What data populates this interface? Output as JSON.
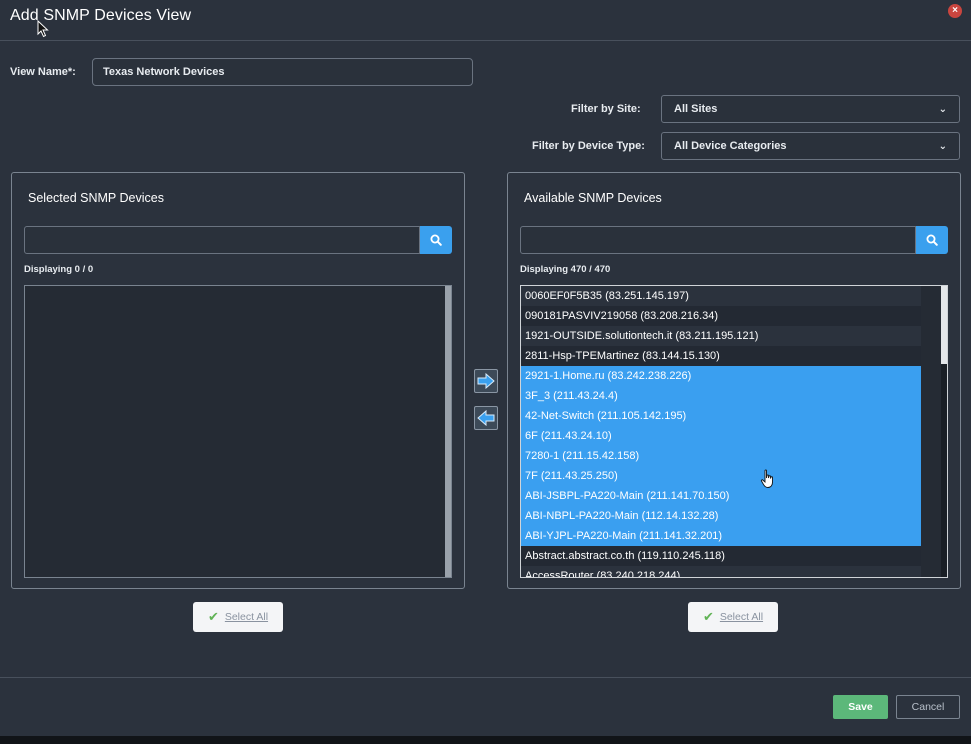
{
  "dialog": {
    "title": "Add SNMP Devices View",
    "close_icon": "close-icon"
  },
  "form": {
    "view_name_label": "View Name*:",
    "view_name_value": "Texas Network Devices",
    "filter_site_label": "Filter by Site:",
    "filter_site_value": "All Sites",
    "filter_type_label": "Filter by Device Type:",
    "filter_type_value": "All Device Categories"
  },
  "selected_panel": {
    "title": "Selected SNMP Devices",
    "search_placeholder": "",
    "count": "Displaying 0 / 0",
    "select_all": "Select All"
  },
  "available_panel": {
    "title": "Available SNMP Devices",
    "search_placeholder": "",
    "count": "Displaying 470 / 470",
    "select_all": "Select All",
    "devices": [
      {
        "label": "0060EF0F5B35 (83.251.145.197)",
        "selected": false
      },
      {
        "label": "090181PASVIV219058 (83.208.216.34)",
        "selected": false
      },
      {
        "label": "1921-OUTSIDE.solutiontech.it (83.211.195.121)",
        "selected": false
      },
      {
        "label": "2811-Hsp-TPEMartinez (83.144.15.130)",
        "selected": false
      },
      {
        "label": "2921-1.Home.ru (83.242.238.226)",
        "selected": true
      },
      {
        "label": "3F_3 (211.43.24.4)",
        "selected": true
      },
      {
        "label": "42-Net-Switch (211.105.142.195)",
        "selected": true
      },
      {
        "label": "6F (211.43.24.10)",
        "selected": true
      },
      {
        "label": "7280-1 (211.15.42.158)",
        "selected": true
      },
      {
        "label": "7F (211.43.25.250)",
        "selected": true
      },
      {
        "label": "ABI-JSBPL-PA220-Main (211.141.70.150)",
        "selected": true
      },
      {
        "label": "ABI-NBPL-PA220-Main (112.14.132.28)",
        "selected": true
      },
      {
        "label": "ABI-YJPL-PA220-Main (211.141.32.201)",
        "selected": true
      },
      {
        "label": "Abstract.abstract.co.th (119.110.245.118)",
        "selected": false
      },
      {
        "label": "AccessRouter (83.240.218.244)",
        "selected": false
      }
    ]
  },
  "footer": {
    "save": "Save",
    "cancel": "Cancel"
  },
  "colors": {
    "background": "#2b323d",
    "accent": "#3aa0ee",
    "save": "#5cb87a",
    "close": "#c9453f"
  }
}
